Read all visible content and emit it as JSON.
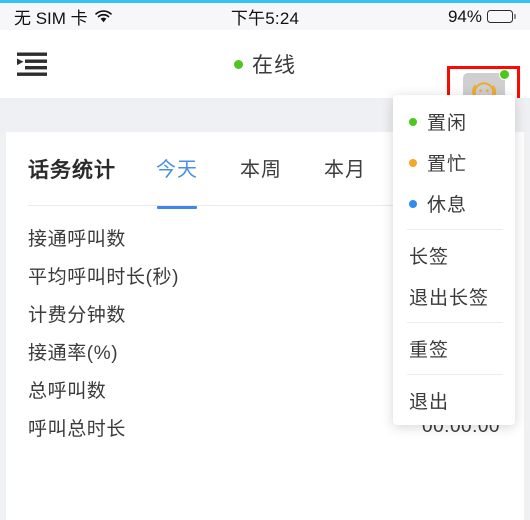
{
  "status_bar": {
    "carrier": "无 SIM 卡",
    "wifi_icon": "wifi-icon",
    "time": "下午5:24",
    "battery_percent": "94%",
    "battery_level": 94,
    "battery_icon": "battery-icon"
  },
  "nav_bar": {
    "menu_icon": "list-menu-icon",
    "status_dot_color": "#4cc71e",
    "title": "在线",
    "avatar": {
      "icon": "agent-headset-avatar-icon",
      "badge_color": "#4cc71e",
      "highlight_color": "#fb0a04"
    }
  },
  "card": {
    "title": "话务统计",
    "tabs": [
      {
        "label": "今天",
        "active": true
      },
      {
        "label": "本周",
        "active": false
      },
      {
        "label": "本月",
        "active": false
      }
    ],
    "active_tab_color": "#4a90e2",
    "stats": [
      {
        "label": "接通呼叫数",
        "value": ""
      },
      {
        "label": "平均呼叫时长(秒)",
        "value": ""
      },
      {
        "label": "计费分钟数",
        "value": ""
      },
      {
        "label": "接通率(%)",
        "value": ""
      },
      {
        "label": "总呼叫数",
        "value": ""
      },
      {
        "label": "呼叫总时长",
        "value": "00:00:00"
      }
    ]
  },
  "dropdown": {
    "groups": [
      {
        "items": [
          {
            "label": "置闲",
            "dot": "#4cc71e"
          },
          {
            "label": "置忙",
            "dot": "#f5a623"
          },
          {
            "label": "休息",
            "dot": "#2f8cf0"
          }
        ]
      },
      {
        "items": [
          {
            "label": "长签",
            "dot": null
          },
          {
            "label": "退出长签",
            "dot": null
          }
        ]
      },
      {
        "items": [
          {
            "label": "重签",
            "dot": null
          }
        ]
      },
      {
        "items": [
          {
            "label": "退出",
            "dot": null
          }
        ]
      }
    ]
  }
}
